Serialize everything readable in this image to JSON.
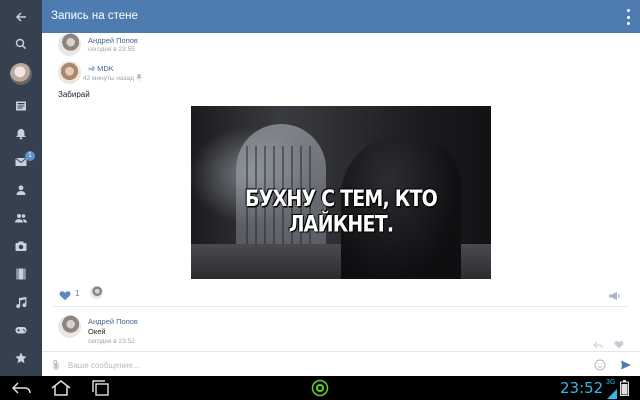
{
  "header": {
    "title": "Запись на стене"
  },
  "sidebar": {
    "unread_badge": "1"
  },
  "wall_post": {
    "author": "Андрей Попов",
    "time": "сегодня в 23:55"
  },
  "repost": {
    "source": "MDK",
    "time": "42 минуты назад",
    "text": "Забирай",
    "image_caption": "БУХНУ С ТЕМ, КТО ЛАЙКНЕТ."
  },
  "actions": {
    "likes_count": "1"
  },
  "comments": [
    {
      "author": "Андрей Попов",
      "text": "Окей",
      "time": "сегодня в 23:52"
    }
  ],
  "composer": {
    "placeholder": "Ваше сообщение..."
  },
  "system_bar": {
    "clock": "23:52",
    "network": "3G"
  },
  "colors": {
    "accent": "#4e7bb0",
    "sidebar": "#35414f",
    "link": "#45678f",
    "clock": "#38b7e6"
  }
}
